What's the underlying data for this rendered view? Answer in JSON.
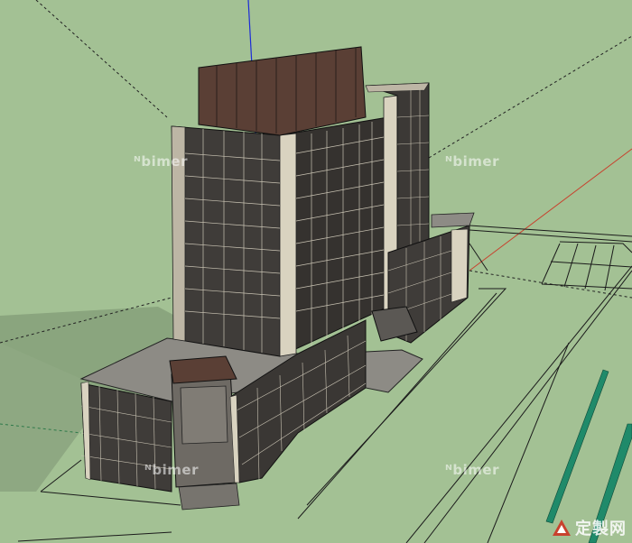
{
  "watermarks": [
    {
      "text": "bimer"
    },
    {
      "text": "bimer"
    },
    {
      "text": "bimer"
    },
    {
      "text": "bimer"
    }
  ],
  "brand": {
    "text": "定製网"
  },
  "colors": {
    "background": "#a3c194",
    "ground_shadow": "#8aa57e",
    "facade_dark": "#3f3c39",
    "facade_light": "#d9d3c0",
    "roof_brown": "#5a3f35",
    "slab_gray": "#8d8b85",
    "axis_blue": "#1c2bd8",
    "axis_red": "#c8422e",
    "axis_green": "#1a8a6a"
  }
}
